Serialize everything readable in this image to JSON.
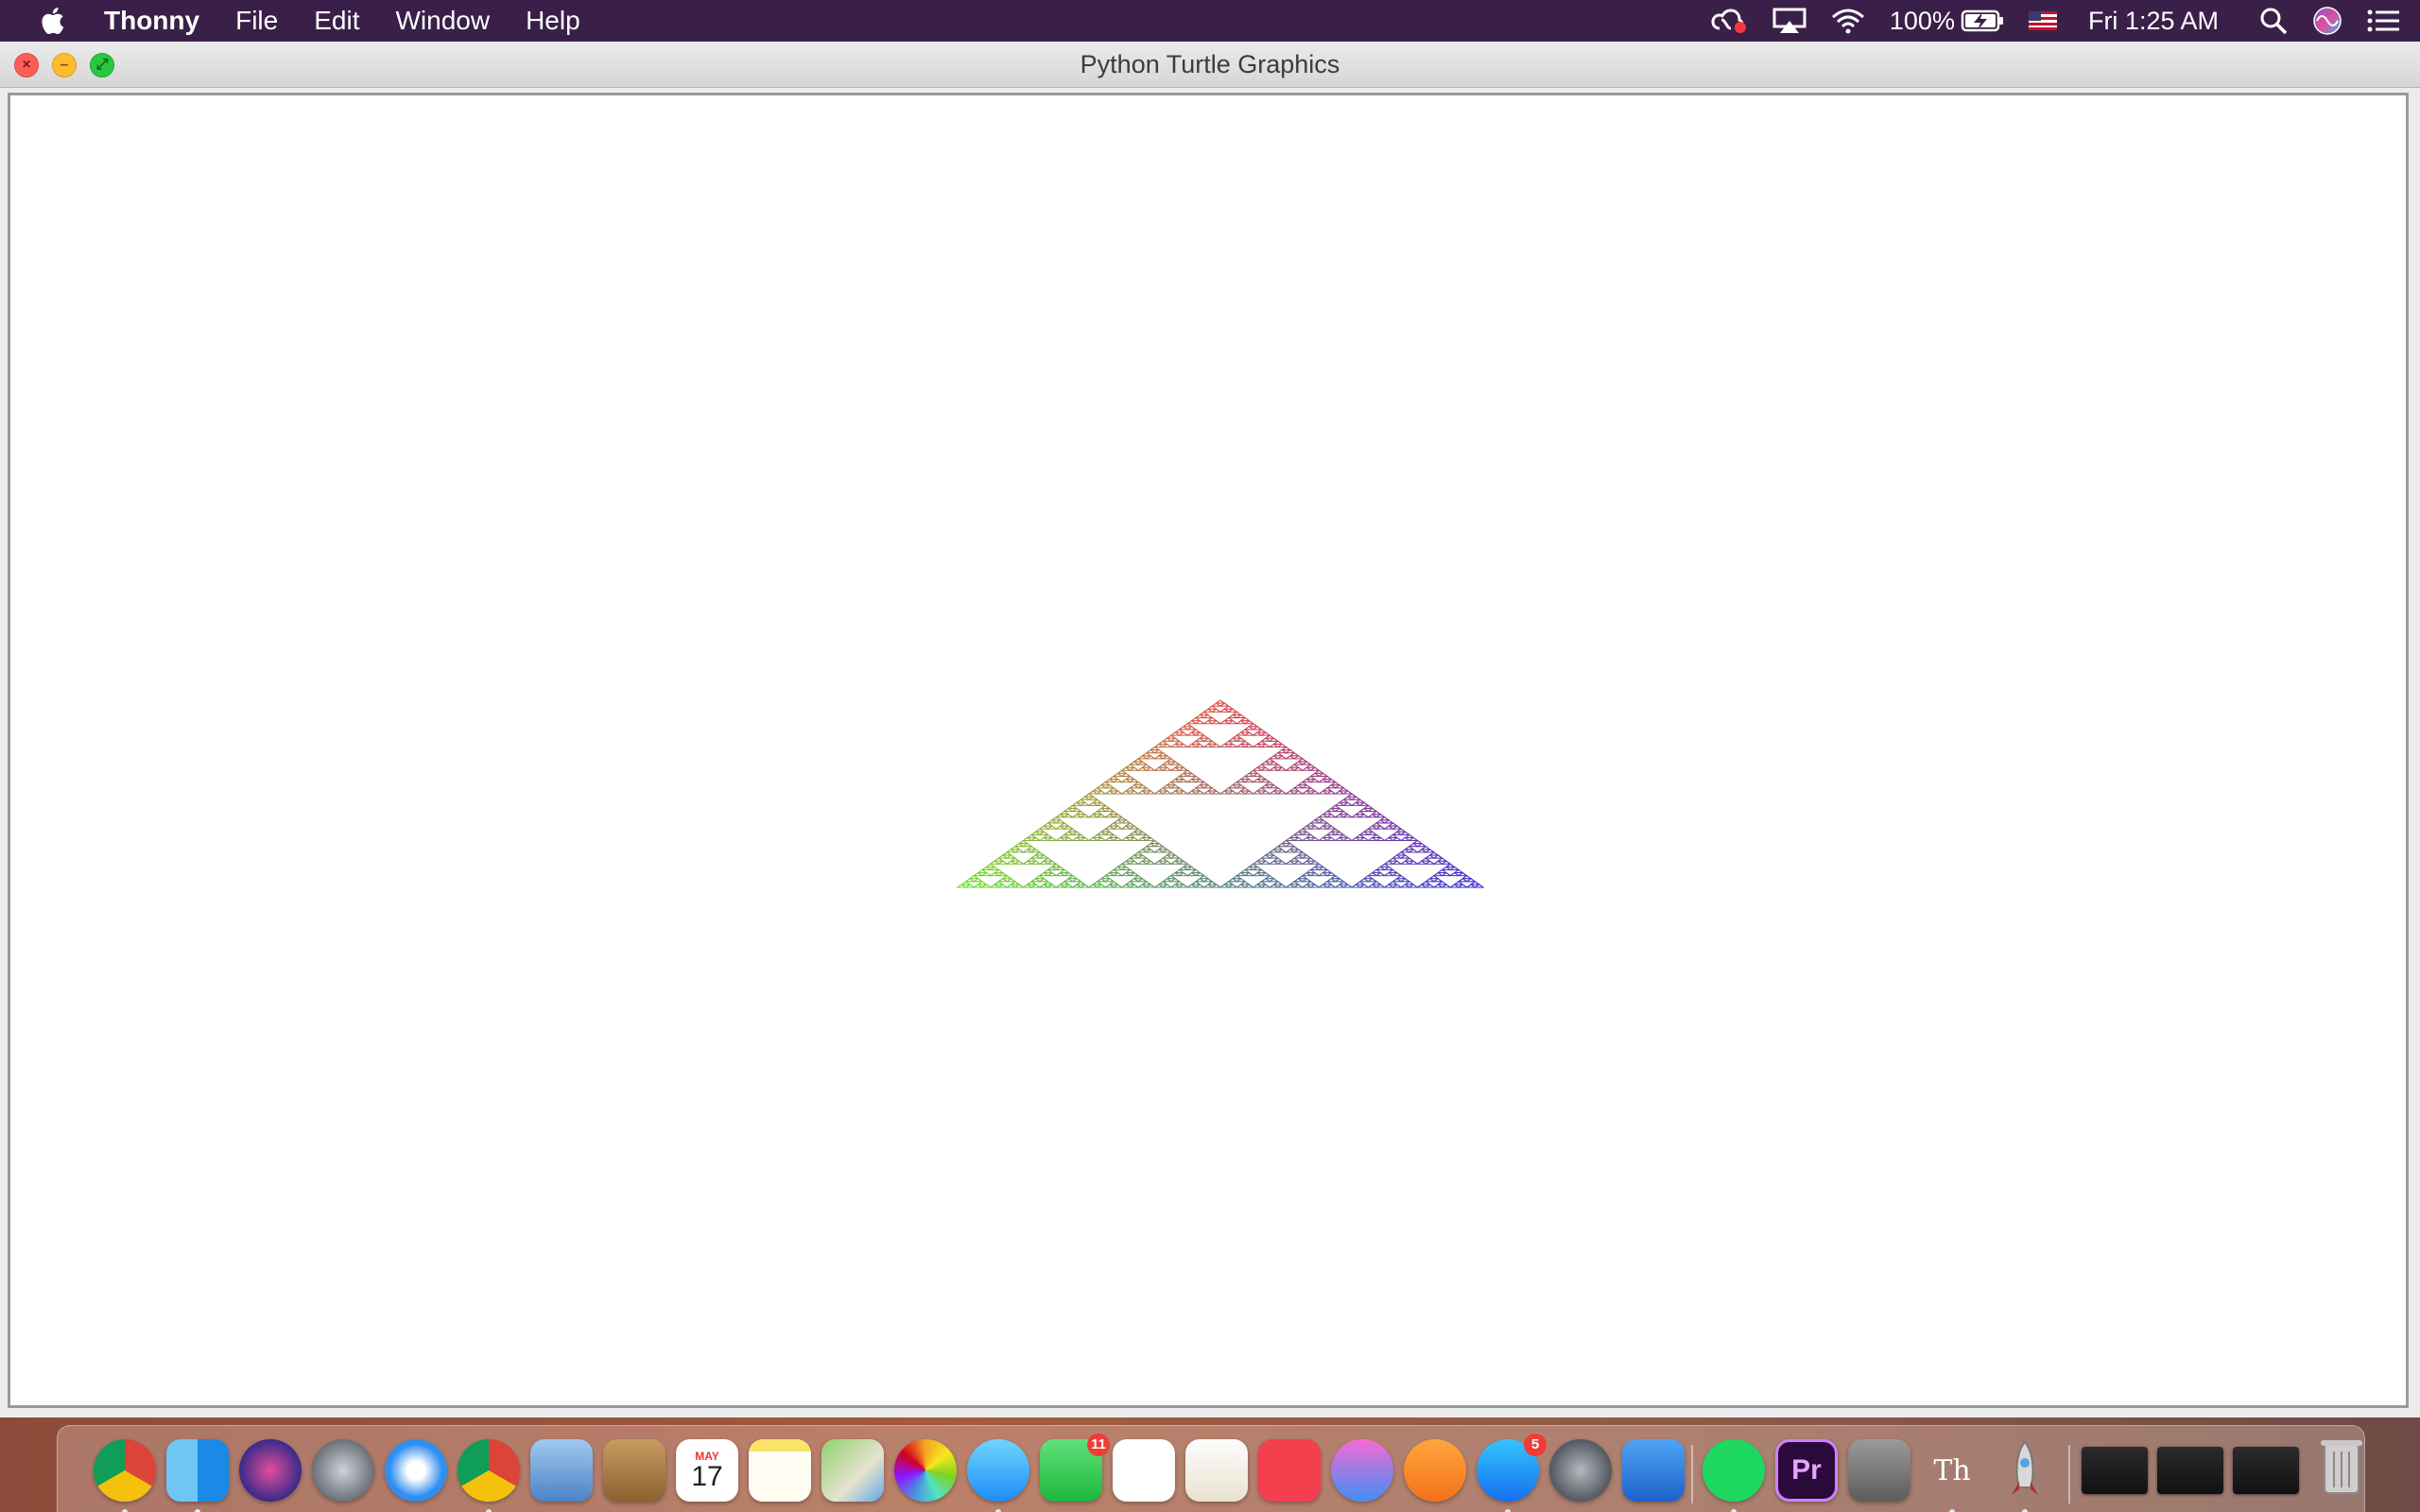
{
  "menubar": {
    "apple_icon": "apple-logo-icon",
    "app_name": "Thonny",
    "menus": [
      "File",
      "Edit",
      "Window",
      "Help"
    ],
    "battery_percent": "100%",
    "clock": "Fri 1:25 AM",
    "status_icons": [
      "creative-cloud-icon",
      "airplay-icon",
      "wifi-icon",
      "battery-charging-icon",
      "us-flag-input-icon",
      "spotlight-search-icon",
      "siri-icon",
      "notification-center-icon"
    ]
  },
  "window": {
    "title": "Python Turtle Graphics",
    "buttons": [
      "close",
      "minimize",
      "zoom"
    ],
    "canvas_background": "#ffffff",
    "drawing": {
      "shape": "Sierpinski triangle",
      "color_gradient": [
        "#e84a4a",
        "#b58a2a",
        "#6ee02a",
        "#a52ad8",
        "#3a2ad8"
      ]
    }
  },
  "dock": {
    "apps": [
      {
        "name": "Google Chrome",
        "icon": "chrome-icon"
      },
      {
        "name": "Finder",
        "icon": "finder-icon"
      },
      {
        "name": "Siri",
        "icon": "siri-icon"
      },
      {
        "name": "Launchpad",
        "icon": "launchpad-icon"
      },
      {
        "name": "Safari",
        "icon": "safari-icon"
      },
      {
        "name": "Google Chrome",
        "icon": "chrome-icon"
      },
      {
        "name": "Mail",
        "icon": "mail-icon"
      },
      {
        "name": "Contacts",
        "icon": "contacts-icon"
      },
      {
        "name": "Calendar",
        "icon": "calendar-icon",
        "month": "MAY",
        "day": "17"
      },
      {
        "name": "Notes",
        "icon": "notes-icon"
      },
      {
        "name": "Maps",
        "icon": "maps-icon"
      },
      {
        "name": "Photos",
        "icon": "photos-icon"
      },
      {
        "name": "Messages",
        "icon": "messages-icon"
      },
      {
        "name": "FaceTime",
        "icon": "facetime-icon",
        "badge": "11"
      },
      {
        "name": "Numbers",
        "icon": "numbers-icon"
      },
      {
        "name": "Pages",
        "icon": "pages-icon"
      },
      {
        "name": "News",
        "icon": "news-icon"
      },
      {
        "name": "iTunes",
        "icon": "music-icon"
      },
      {
        "name": "Books",
        "icon": "books-icon"
      },
      {
        "name": "App Store",
        "icon": "app-store-icon",
        "badge": "5"
      },
      {
        "name": "System Preferences",
        "icon": "system-preferences-icon"
      },
      {
        "name": "Keynote",
        "icon": "keynote-icon"
      },
      {
        "name": "Spotify",
        "icon": "spotify-icon"
      },
      {
        "name": "Premiere Pro",
        "icon": "premiere-icon",
        "label": "Pr"
      },
      {
        "name": "Calculator",
        "icon": "calculator-icon"
      },
      {
        "name": "Thonny",
        "icon": "thonny-icon",
        "label": "Th"
      },
      {
        "name": "Rocket",
        "icon": "rocket-icon"
      }
    ],
    "trash_icon": "trash-icon"
  }
}
